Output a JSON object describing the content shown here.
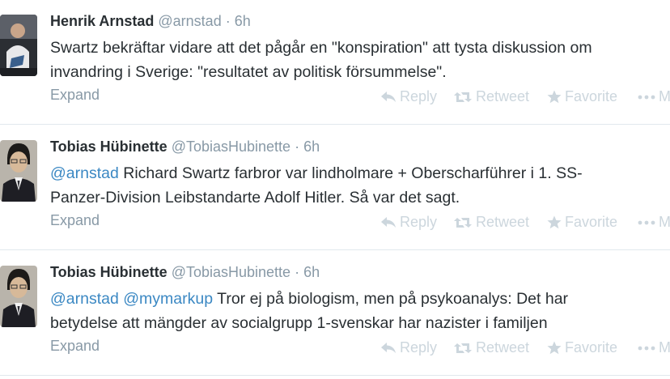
{
  "tweets": [
    {
      "fullname": "Henrik Arnstad",
      "username": "@arnstad",
      "separator": "·",
      "time": "6h",
      "text_lines": [
        [
          {
            "text": "Swartz bekräftar vidare att det pågår en \"konspiration\" att tysta diskussion om",
            "mention": false
          }
        ],
        [
          {
            "text": "invandring i Sverige: \"resultatet av politisk försummelse\".",
            "mention": false
          }
        ]
      ],
      "expand": "Expand",
      "actions": {
        "reply": "Reply",
        "retweet": "Retweet",
        "favorite": "Favorite",
        "more": "M"
      }
    },
    {
      "fullname": "Tobias Hübinette",
      "username": "@TobiasHubinette",
      "separator": "·",
      "time": "6h",
      "text_lines": [
        [
          {
            "text": "@arnstad",
            "mention": true
          },
          {
            "text": " Richard Swartz farbror var lindholmare + Oberscharführer i 1. SS-",
            "mention": false
          }
        ],
        [
          {
            "text": "Panzer-Division Leibstandarte Adolf Hitler. Så var det sagt.",
            "mention": false
          }
        ]
      ],
      "expand": "Expand",
      "actions": {
        "reply": "Reply",
        "retweet": "Retweet",
        "favorite": "Favorite",
        "more": "M"
      }
    },
    {
      "fullname": "Tobias Hübinette",
      "username": "@TobiasHubinette",
      "separator": "·",
      "time": "6h",
      "text_lines": [
        [
          {
            "text": "@arnstad",
            "mention": true
          },
          {
            "text": " ",
            "mention": false
          },
          {
            "text": "@mymarkup",
            "mention": true
          },
          {
            "text": " Tror ej på biologism, men på psykoanalys: Det har",
            "mention": false
          }
        ],
        [
          {
            "text": "betydelse att mängder av socialgrupp 1-svenskar har nazister i familjen",
            "mention": false
          }
        ]
      ],
      "expand": "Expand",
      "actions": {
        "reply": "Reply",
        "retweet": "Retweet",
        "favorite": "Favorite",
        "more": "M"
      }
    }
  ],
  "icons": {
    "reply": "reply-icon",
    "retweet": "retweet-icon",
    "favorite": "star-icon",
    "more": "more-dots-icon"
  },
  "colors": {
    "link": "#3b88c3",
    "muted": "#8899a6",
    "faint": "#ccd6dd",
    "text": "#292f33"
  }
}
